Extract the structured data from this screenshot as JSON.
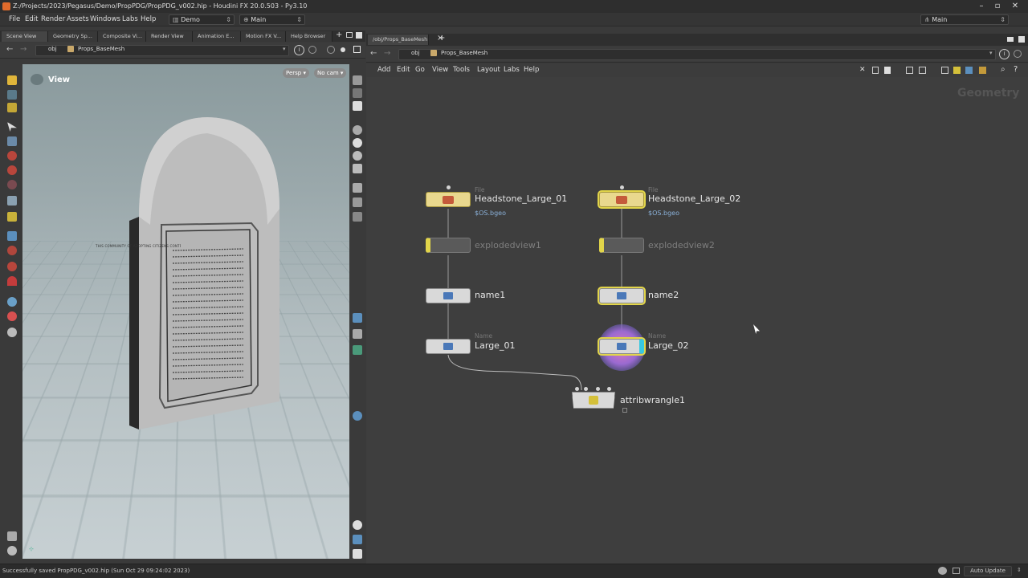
{
  "window": {
    "title": "Z:/Projects/2023/Pegasus/Demo/PropPDG/PropPDG_v002.hip - Houdini FX 20.0.503 - Py3.10",
    "minimize": "–",
    "maximize": "▫",
    "close": "✕"
  },
  "menubar": {
    "items": [
      "File",
      "Edit",
      "Render",
      "Assets",
      "Windows",
      "Labs",
      "Help"
    ],
    "desktop": "Demo",
    "workspace": "Main",
    "right_combo": "Main"
  },
  "left_pane": {
    "tabs": [
      "Scene View",
      "Geometry Sp...",
      "Composite Vi...",
      "Render View",
      "Animation E...",
      "Motion FX V...",
      "Help Browser"
    ],
    "path_root": "obj",
    "path_node": "Props_BaseMesh",
    "viewport_label": "View",
    "persp": "Persp",
    "cam": "No cam"
  },
  "right_pane": {
    "tab": "/obj/Props_BaseMesh",
    "path_root": "obj",
    "path_node": "Props_BaseMesh",
    "menu": [
      "Add",
      "Edit",
      "Go",
      "View",
      "Tools",
      "Layout",
      "Labs",
      "Help"
    ],
    "context_label": "Geometry"
  },
  "nodes": {
    "file1": {
      "type": "File",
      "name": "Headstone_Large_01",
      "sub": "$OS.bgeo"
    },
    "file2": {
      "type": "File",
      "name": "Headstone_Large_02",
      "sub": "$OS.bgeo"
    },
    "exploded1": {
      "name": "explodedview1"
    },
    "exploded2": {
      "name": "explodedview2"
    },
    "name1": {
      "name": "name1"
    },
    "name2": {
      "name": "name2"
    },
    "large1": {
      "type": "Name",
      "name": "Large_01"
    },
    "large2": {
      "type": "Name",
      "name": "Large_02"
    },
    "wrangle": {
      "name": "attribwrangle1"
    }
  },
  "headstone_text": "THIS COMMUNITY OF ADOPTING CITIZENS CONTRIBUTED",
  "statusbar": {
    "message": "Successfully saved PropPDG_v002.hip (Sun Oct 29 09:24:02 2023)",
    "auto_update": "Auto Update"
  },
  "colors": {
    "file_node": "#e9d88e",
    "selection": "#e2d54a",
    "path_link": "#8ab0d8",
    "orange_icon": "#e06b2c"
  }
}
